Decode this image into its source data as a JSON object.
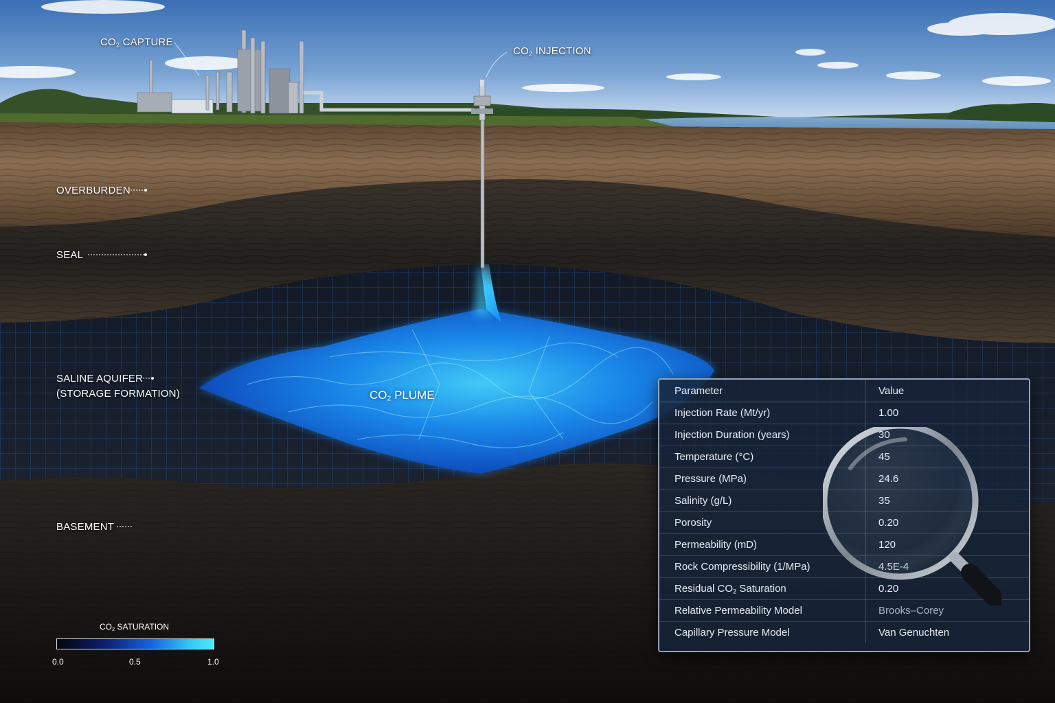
{
  "labels": {
    "capture": {
      "prefix": "CO",
      "sub": "2",
      "suffix": " CAPTURE"
    },
    "injection": {
      "prefix": "CO",
      "sub": "2",
      "suffix": " INJECTION"
    },
    "overburden": "OVERBURDEN",
    "seal": "SEAL",
    "aquifer_line1": "SALINE AQUIFER",
    "aquifer_line2": "(STORAGE FORMATION)",
    "basement": "BASEMENT",
    "plume": {
      "prefix": "CO",
      "sub": "2",
      "suffix": " PLUME"
    }
  },
  "legend": {
    "title": {
      "prefix": "CO",
      "sub": "2",
      "suffix": " SATURATION"
    },
    "ticks": [
      "0.0",
      "0.5",
      "1.0"
    ],
    "colors": [
      "#05060e",
      "#0b1e6a",
      "#1663e0",
      "#34c8f2",
      "#49eaff"
    ]
  },
  "table": {
    "headers": [
      "Parameter",
      "Value"
    ],
    "rows": [
      {
        "param": "Injection Rate (Mt/yr)",
        "value": "1.00"
      },
      {
        "param": "Injection Duration (years)",
        "value": "30"
      },
      {
        "param": "Temperature (°C)",
        "value": "45"
      },
      {
        "param": "Pressure (MPa)",
        "value": "24.6"
      },
      {
        "param": "Salinity (g/L)",
        "value": "35"
      },
      {
        "param": "Porosity",
        "value": "0.20"
      },
      {
        "param": "Permeability (mD)",
        "value": "120"
      },
      {
        "param": "Rock Compressibility (1/MPa)",
        "value": "4.5E-4"
      },
      {
        "param_prefix": "Residual CO",
        "param_sub": "2",
        "param_suffix": " Saturation",
        "value": "0.20"
      },
      {
        "param": "Relative Permeability Model",
        "value": "Brooks–Corey"
      },
      {
        "param": "Capillary Pressure Model",
        "value": "Van Genuchten"
      }
    ]
  },
  "colors": {
    "sky_top": "#3f74b8",
    "sky_horizon": "#c9dbef",
    "water": "#5f8fbd",
    "overburden": "#7b6046",
    "seal": "#2a2520",
    "aquifer": "#161b24",
    "basement": "#1d1a18",
    "plume": "#1aa7ff",
    "panel_bg": "#162438"
  },
  "icons": [
    "magnifier-icon",
    "refinery-icon",
    "wellhead-icon"
  ]
}
